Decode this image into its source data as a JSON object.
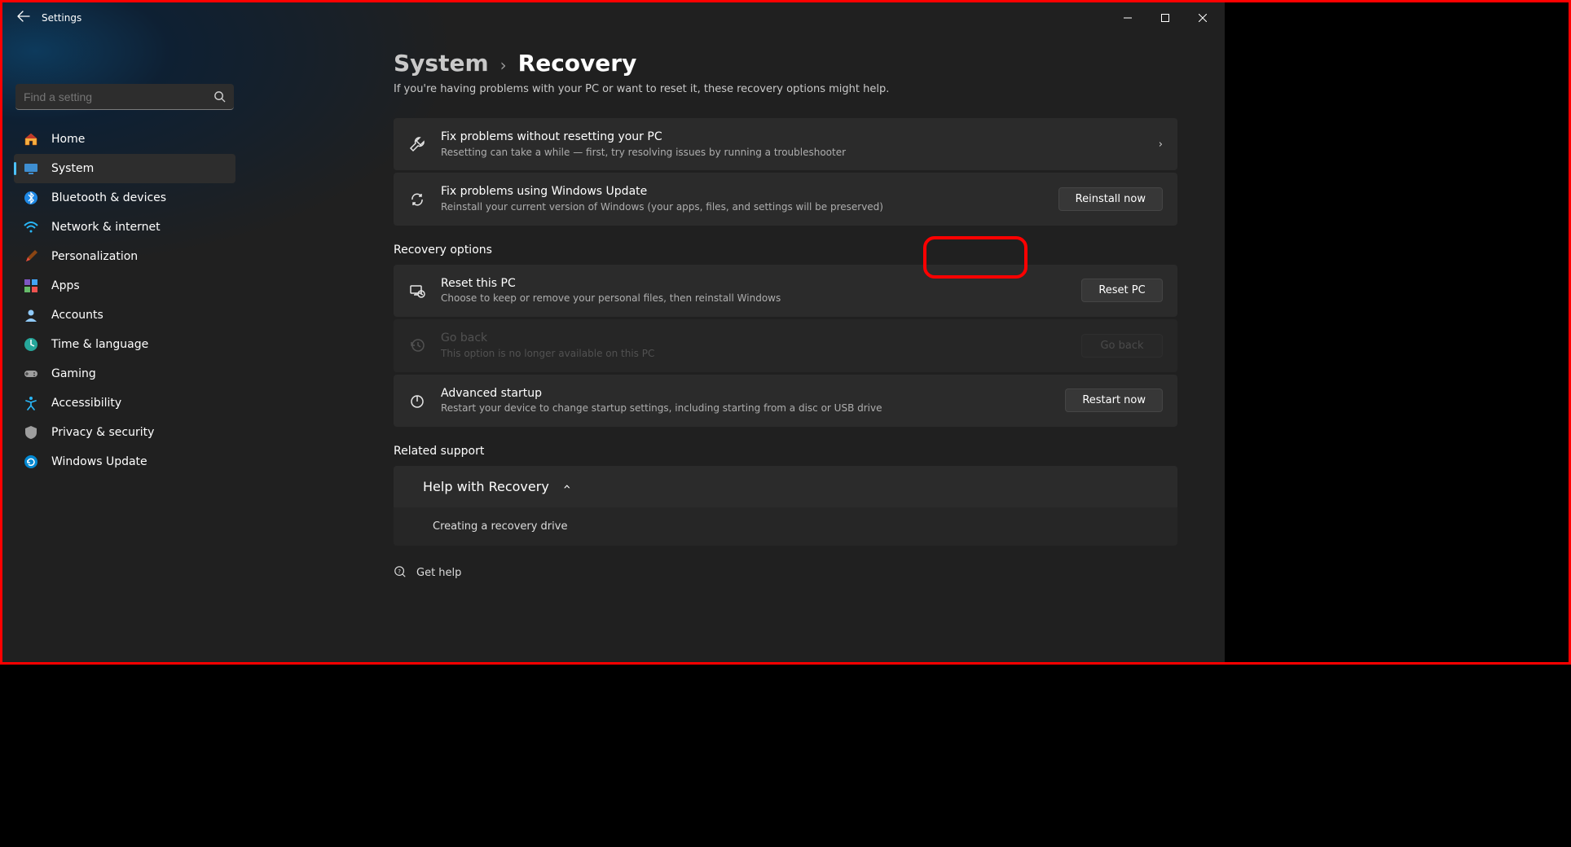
{
  "window": {
    "title": "Settings"
  },
  "search": {
    "placeholder": "Find a setting"
  },
  "sidebar": {
    "items": [
      {
        "label": "Home"
      },
      {
        "label": "System"
      },
      {
        "label": "Bluetooth & devices"
      },
      {
        "label": "Network & internet"
      },
      {
        "label": "Personalization"
      },
      {
        "label": "Apps"
      },
      {
        "label": "Accounts"
      },
      {
        "label": "Time & language"
      },
      {
        "label": "Gaming"
      },
      {
        "label": "Accessibility"
      },
      {
        "label": "Privacy & security"
      },
      {
        "label": "Windows Update"
      }
    ]
  },
  "breadcrumb": {
    "parent": "System",
    "current": "Recovery"
  },
  "intro": "If you're having problems with your PC or want to reset it, these recovery options might help.",
  "cards": {
    "fix_no_reset": {
      "title": "Fix problems without resetting your PC",
      "subtitle": "Resetting can take a while — first, try resolving issues by running a troubleshooter"
    },
    "fix_wu": {
      "title": "Fix problems using Windows Update",
      "subtitle": "Reinstall your current version of Windows (your apps, files, and settings will be preserved)",
      "button": "Reinstall now"
    }
  },
  "sections": {
    "recovery": "Recovery options",
    "related": "Related support"
  },
  "recovery": {
    "reset": {
      "title": "Reset this PC",
      "subtitle": "Choose to keep or remove your personal files, then reinstall Windows",
      "button": "Reset PC"
    },
    "goback": {
      "title": "Go back",
      "subtitle": "This option is no longer available on this PC",
      "button": "Go back"
    },
    "advanced": {
      "title": "Advanced startup",
      "subtitle": "Restart your device to change startup settings, including starting from a disc or USB drive",
      "button": "Restart now"
    }
  },
  "help": {
    "title": "Help with Recovery",
    "item": "Creating a recovery drive"
  },
  "get_help": "Get help"
}
